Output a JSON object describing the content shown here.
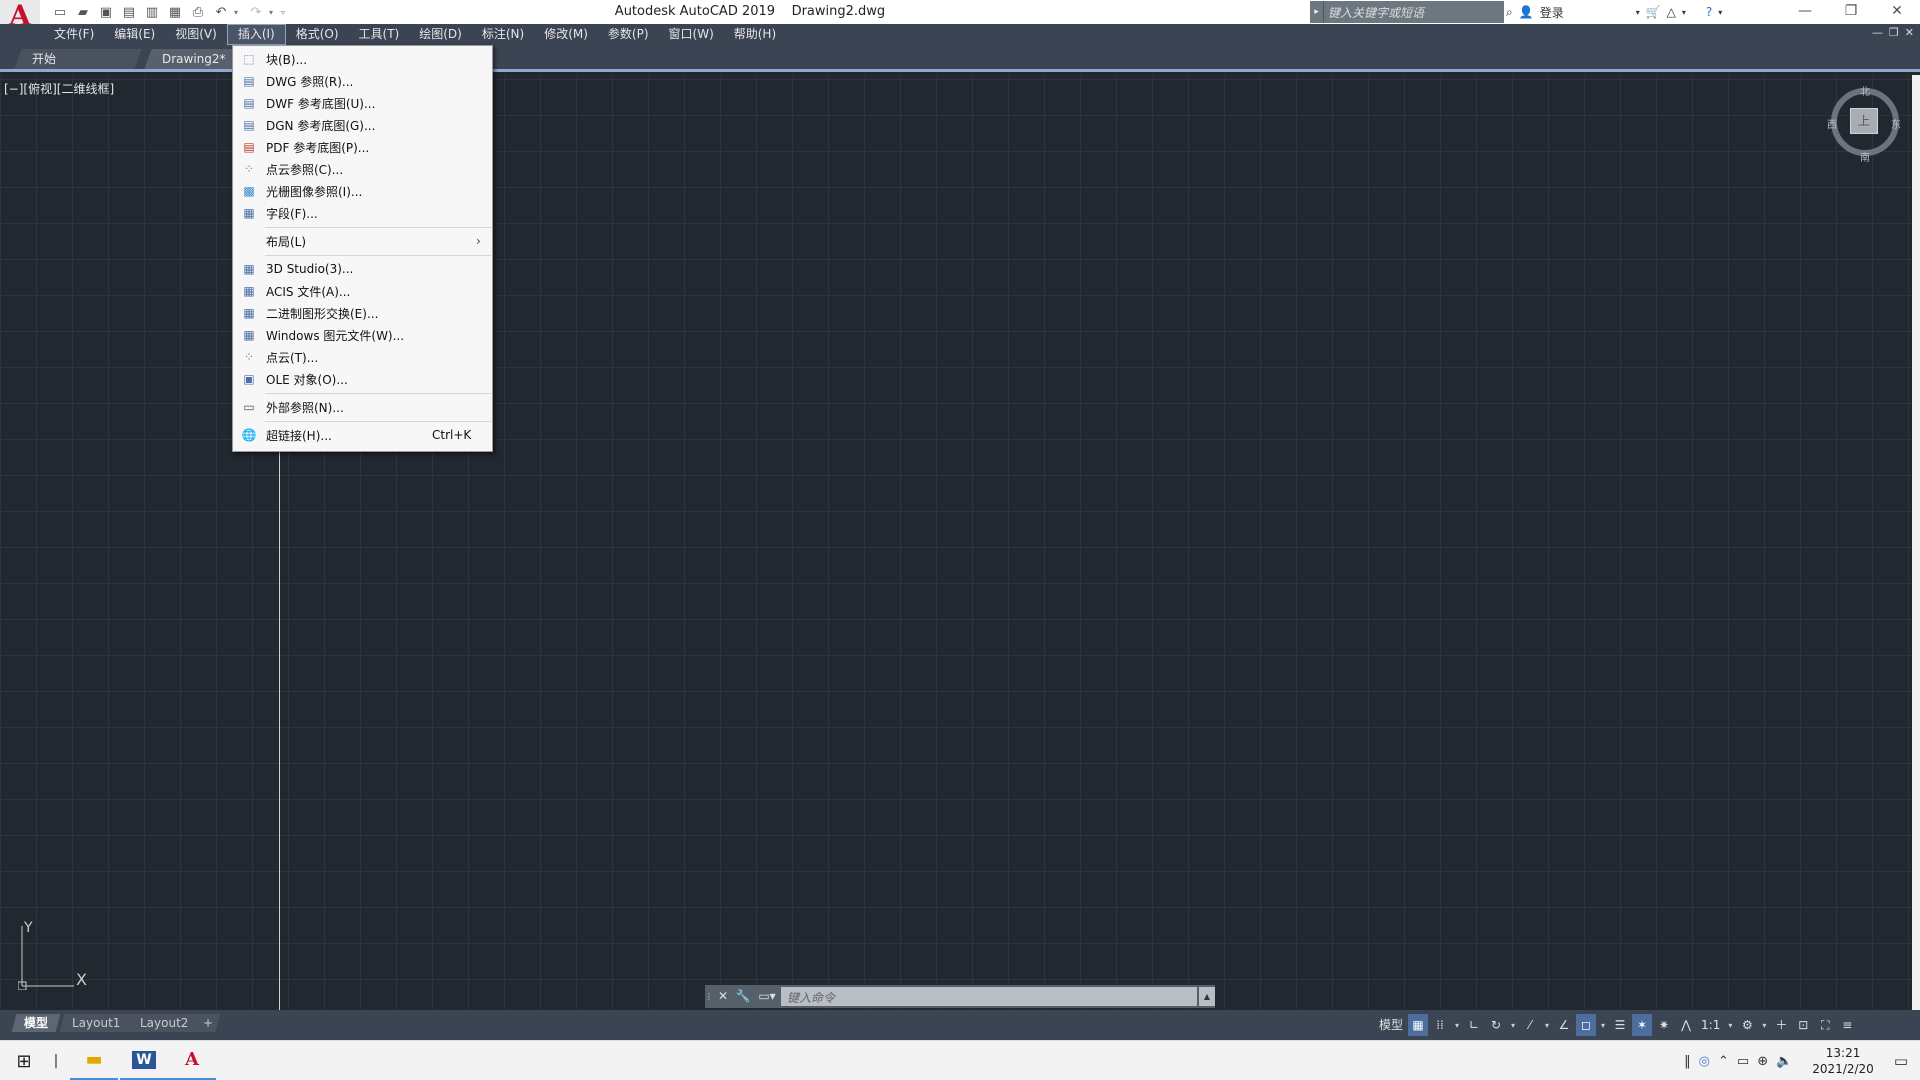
{
  "title_bar": {
    "app_name": "Autodesk AutoCAD 2019",
    "document": "Drawing2.dwg",
    "search_placeholder": "键入关键字或短语",
    "sign_in": "登录"
  },
  "menu_bar": [
    {
      "label": "文件(F)"
    },
    {
      "label": "编辑(E)"
    },
    {
      "label": "视图(V)"
    },
    {
      "label": "插入(I)"
    },
    {
      "label": "格式(O)"
    },
    {
      "label": "工具(T)"
    },
    {
      "label": "绘图(D)"
    },
    {
      "label": "标注(N)"
    },
    {
      "label": "修改(M)"
    },
    {
      "label": "参数(P)"
    },
    {
      "label": "窗口(W)"
    },
    {
      "label": "帮助(H)"
    }
  ],
  "file_tabs": {
    "start": "开始",
    "drawing": "Drawing2*"
  },
  "viewport": {
    "label": "[−][俯视][二维线框]"
  },
  "viewcube": {
    "north": "北",
    "south": "南",
    "east": "东",
    "west": "西",
    "face": "上"
  },
  "ucs": {
    "x": "X",
    "y": "Y"
  },
  "insert_menu": {
    "items": [
      {
        "label": "块(B)...",
        "icon": "block-icon"
      },
      {
        "label": "DWG 参照(R)...",
        "icon": "dwg-icon"
      },
      {
        "label": "DWF 参考底图(U)...",
        "icon": "dwf-icon"
      },
      {
        "label": "DGN 参考底图(G)...",
        "icon": "dgn-icon"
      },
      {
        "label": "PDF 参考底图(P)...",
        "icon": "pdf-icon"
      },
      {
        "label": "点云参照(C)...",
        "icon": "point-cloud-icon"
      },
      {
        "label": "光栅图像参照(I)...",
        "icon": "raster-image-icon"
      },
      {
        "label": "字段(F)...",
        "icon": "field-icon"
      },
      {
        "label": "布局(L)",
        "icon": "",
        "submenu": true
      },
      {
        "label": "3D Studio(3)...",
        "icon": "import-3ds-icon"
      },
      {
        "label": "ACIS 文件(A)...",
        "icon": "import-acis-icon"
      },
      {
        "label": "二进制图形交换(E)...",
        "icon": "import-dxb-icon"
      },
      {
        "label": "Windows 图元文件(W)...",
        "icon": "import-wmf-icon"
      },
      {
        "label": "点云(T)...",
        "icon": "point-cloud-attach-icon"
      },
      {
        "label": "OLE 对象(O)...",
        "icon": "ole-icon"
      },
      {
        "label": "外部参照(N)...",
        "icon": "xref-icon"
      },
      {
        "label": "超链接(H)...",
        "icon": "hyperlink-icon",
        "shortcut": "Ctrl+K"
      }
    ]
  },
  "command_line": {
    "placeholder": "键入命令"
  },
  "layout_tabs": {
    "model": "模型",
    "layout1": "Layout1",
    "layout2": "Layout2",
    "add": "+"
  },
  "status_bar": {
    "model": "模型",
    "scale": "1:1"
  },
  "taskbar": {
    "time": "13:21",
    "date": "2021/2/20"
  },
  "colors": {
    "canvas": "#212830",
    "chrome": "#3b4453",
    "accent": "#4c6d9e",
    "autocad_red": "#c8102e"
  }
}
